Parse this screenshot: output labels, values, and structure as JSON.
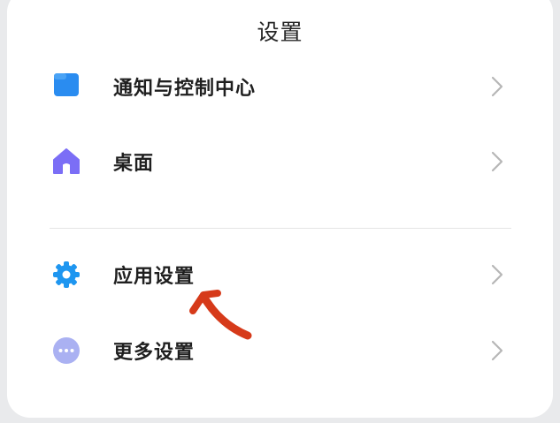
{
  "header": {
    "title": "设置"
  },
  "settings": {
    "items": [
      {
        "label": "通知与控制中心",
        "icon": "folder-icon",
        "color": "#2a8cf0"
      },
      {
        "label": "桌面",
        "icon": "home-icon",
        "color": "#7b6ef6"
      },
      {
        "label": "应用设置",
        "icon": "gear-icon",
        "color": "#1e96f0"
      },
      {
        "label": "更多设置",
        "icon": "more-dots-icon",
        "color": "#aab1f2"
      }
    ]
  },
  "colors": {
    "background": "#e9eaec",
    "card": "#ffffff",
    "annotation_arrow": "#d63a1a"
  }
}
